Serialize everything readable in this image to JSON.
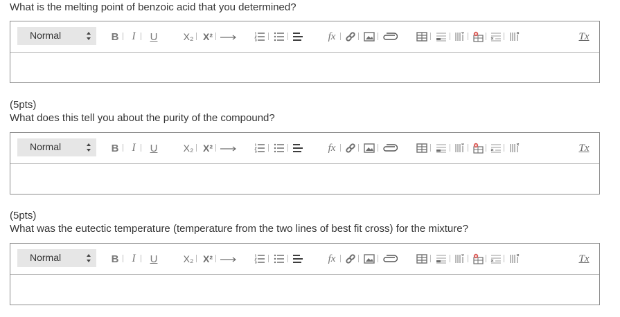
{
  "questions": [
    {
      "points": "",
      "text": "What is the melting point of benzoic acid that you determined?"
    },
    {
      "points": "(5pts)",
      "text": "What does this tell you about the purity of the compound?"
    },
    {
      "points": "(5pts)",
      "text": "What was the eutectic temperature (temperature from the two lines of best fit cross) for the mixture?"
    }
  ],
  "toolbar": {
    "format_value": "Normal",
    "bold_label": "B",
    "italic_label": "I",
    "underline_label": "U",
    "subscript_label": "X₂",
    "superscript_label": "X²",
    "formula_label": "fx",
    "clear_label": "Tx"
  },
  "icons": [
    "bold-icon",
    "italic-icon",
    "underline-icon",
    "subscript-icon",
    "superscript-icon",
    "arrow-icon",
    "ordered-list-icon",
    "bullet-list-icon",
    "align-icon",
    "formula-icon",
    "link-icon",
    "image-icon",
    "attach-icon",
    "table-icon",
    "table-row-icon",
    "table-col-icon",
    "cell-icon",
    "delete-row-icon",
    "delete-col-icon",
    "clear-format-icon"
  ],
  "colors": {
    "border": "#8a8a8a",
    "select_bg": "#e6e6e6",
    "icon": "#6f6f6f"
  }
}
